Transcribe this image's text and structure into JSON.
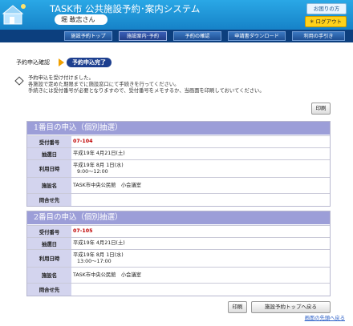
{
  "header": {
    "system_title": "TASK市 公共施設予約･案内システム",
    "user_name": "堀 敢志さん",
    "help_label": "お困りの方",
    "logout_label": "✳ ログアウト"
  },
  "nav": {
    "tabs": [
      {
        "label": "施設予約トップ",
        "active": false
      },
      {
        "label": "施設案内･予約",
        "active": true
      },
      {
        "label": "予約の確認",
        "active": false
      },
      {
        "label": "申請書ダウンロード",
        "active": false
      },
      {
        "label": "利用の手引き",
        "active": false
      }
    ]
  },
  "steps": {
    "previous": "予約申込確認",
    "current": "予約申込完了"
  },
  "message": {
    "lines": [
      "予約申込を受け付けました。",
      "各施設で定めた期限までに施設窓口にて手続きを行ってください。",
      "手続きには受付番号が必要となりますので、受付番号をメモするか、当画面を印刷しておいてください。"
    ]
  },
  "print_label": "印刷",
  "bookings": [
    {
      "title": "1番目の申込（個別抽選）",
      "fields": {
        "receipt_label": "受付番号",
        "receipt_value": "07-104",
        "lottery_label": "抽選日",
        "lottery_value": "平成19年 4月21日(土)",
        "use_label": "利用日時",
        "use_date": "平成19年 8月 1日(水)",
        "use_time": "9:00～12:00",
        "facility_label": "施設名",
        "facility_value": "TASK市中央公民館　小会議室",
        "contact_label": "問合せ先",
        "contact_value": ""
      }
    },
    {
      "title": "2番目の申込（個別抽選）",
      "fields": {
        "receipt_label": "受付番号",
        "receipt_value": "07-105",
        "lottery_label": "抽選日",
        "lottery_value": "平成19年 4月21日(土)",
        "use_label": "利用日時",
        "use_date": "平成19年 8月 1日(水)",
        "use_time": "13:00～17:00",
        "facility_label": "施設名",
        "facility_value": "TASK市中央公民館　小会議室",
        "contact_label": "問合せ先",
        "contact_value": ""
      }
    }
  ],
  "bottom": {
    "print_label": "印刷",
    "top_button_label": "施設予約トップへ戻る",
    "page_top_link": "画面の先頭へ戻る"
  },
  "colors": {
    "header_blue": "#1682c8",
    "nav_navy": "#0c3f7e",
    "panel_head": "#9c9ed8",
    "label_cell": "#d3d4ee",
    "receipt_red": "#c00000"
  }
}
